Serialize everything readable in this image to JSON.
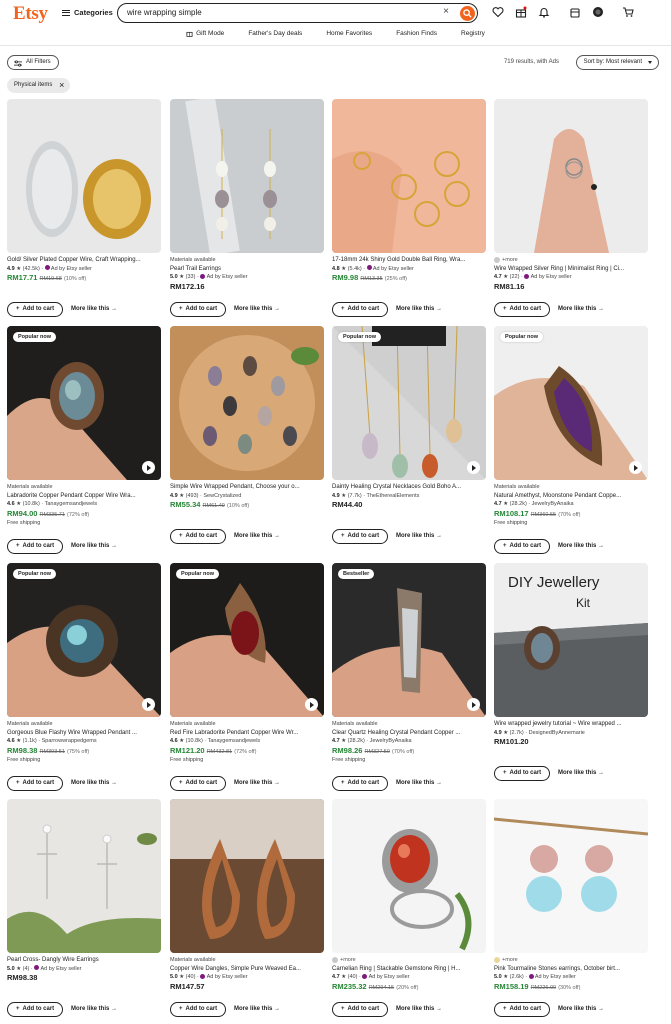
{
  "header": {
    "logo": "Etsy",
    "categories_label": "Categories",
    "search_value": "wire wrapping simple",
    "clear_symbol": "×"
  },
  "nav": [
    "Gift Mode",
    "Father's Day deals",
    "Home Favorites",
    "Fashion Finds",
    "Registry"
  ],
  "filters": {
    "all_filters": "All Filters",
    "results": "719 results, with Ads",
    "sort": "Sort by: Most relevant",
    "chip": "Physical items",
    "chip_x": "×"
  },
  "actions": {
    "add_to_cart": "Add to cart",
    "more_like_this": "More like this"
  },
  "colors": {
    "brand": "#f1641e",
    "sale_green": "#258635"
  },
  "products": [
    {
      "title": "Gold/ Silver Plated Copper Wire, Craft Wrapping...",
      "top": "",
      "rating": "4.9",
      "reviews": "(42.5k)",
      "seller": "Ad by Etsy seller",
      "ad": true,
      "price": "RM17.71",
      "orig": "RM19.68",
      "off": "(10% off)",
      "sale": true,
      "ship": "",
      "badge": "",
      "video": false
    },
    {
      "title": "Pearl Trail Earrings",
      "top": "Materials available",
      "rating": "5.0",
      "reviews": "(33)",
      "seller": "Ad by Etsy seller",
      "ad": true,
      "price": "RM172.16",
      "orig": "",
      "off": "",
      "sale": false,
      "ship": "",
      "badge": "",
      "video": false
    },
    {
      "title": "17-18mm 24k Shiny Gold Double Ball Ring, Wra...",
      "top": "",
      "rating": "4.8",
      "reviews": "(5.4k)",
      "seller": "Ad by Etsy seller",
      "ad": true,
      "price": "RM9.98",
      "orig": "RM13.35",
      "off": "(25% off)",
      "sale": true,
      "ship": "",
      "badge": "",
      "video": false
    },
    {
      "title": "Wire Wrapped Silver Ring | Minimalist Ring | Ci...",
      "top": "+more",
      "rating": "4.7",
      "reviews": "(22)",
      "seller": "Ad by Etsy seller",
      "ad": true,
      "price": "RM81.16",
      "orig": "",
      "off": "",
      "sale": false,
      "ship": "",
      "badge": "",
      "video": false
    },
    {
      "title": "Labradorite Copper Pendant Copper Wire Wra...",
      "top": "Materials available",
      "rating": "4.6",
      "reviews": "(10.8k)",
      "seller": "Tanaygemsandjewels",
      "ad": false,
      "price": "RM94.00",
      "orig": "RM335.71",
      "off": "(72% off)",
      "sale": true,
      "ship": "Free shipping",
      "badge": "Popular now",
      "video": true
    },
    {
      "title": "Simple Wire Wrapped Pendant, Choose your o...",
      "top": "",
      "rating": "4.9",
      "reviews": "(493)",
      "seller": "SewCrystalized",
      "ad": false,
      "price": "RM55.34",
      "orig": "RM61.49",
      "off": "(10% off)",
      "sale": true,
      "ship": "",
      "badge": "",
      "video": false
    },
    {
      "title": "Dainty Healing Crystal Necklaces Gold Boho A...",
      "top": "",
      "rating": "4.9",
      "reviews": "(7.7k)",
      "seller": "TheEtherealElements",
      "ad": false,
      "price": "RM44.40",
      "orig": "",
      "off": "",
      "sale": false,
      "ship": "",
      "badge": "Popular now",
      "video": true
    },
    {
      "title": "Natural Amethyst, Moonstone Pendant Coppe...",
      "top": "Materials available",
      "rating": "4.7",
      "reviews": "(28.2k)",
      "seller": "JewelryByAnaika",
      "ad": false,
      "price": "RM108.17",
      "orig": "RM360.55",
      "off": "(70% off)",
      "sale": true,
      "ship": "Free shipping",
      "badge": "Popular now",
      "video": true
    },
    {
      "title": "Gorgeous Blue Flashy Wire Wrapped Pendant ...",
      "top": "Materials available",
      "rating": "4.6",
      "reviews": "(1.1k)",
      "seller": "Sparrowwrappedgems",
      "ad": false,
      "price": "RM98.38",
      "orig": "RM393.51",
      "off": "(75% off)",
      "sale": true,
      "ship": "Free shipping",
      "badge": "Popular now",
      "video": true
    },
    {
      "title": "Red Fire Labradorite Pendant Copper Wire Wr...",
      "top": "Materials available",
      "rating": "4.6",
      "reviews": "(10.8k)",
      "seller": "Tanaygemsandjewels",
      "ad": false,
      "price": "RM121.20",
      "orig": "RM432.81",
      "off": "(72% off)",
      "sale": true,
      "ship": "Free shipping",
      "badge": "Popular now",
      "video": true
    },
    {
      "title": "Clear Quartz Healing Crystal Pendant Copper ...",
      "top": "Materials available",
      "rating": "4.7",
      "reviews": "(28.2k)",
      "seller": "JewelryByAnaika",
      "ad": false,
      "price": "RM98.26",
      "orig": "RM327.50",
      "off": "(70% off)",
      "sale": true,
      "ship": "Free shipping",
      "badge": "Bestseller",
      "video": true
    },
    {
      "title": "Wire wrapped jewelry tutorial ~ Wire wrapped ...",
      "top": "",
      "rating": "4.9",
      "reviews": "(2.7k)",
      "seller": "DesignedByAnnemarie",
      "ad": false,
      "price": "RM101.20",
      "orig": "",
      "off": "",
      "sale": false,
      "ship": "",
      "badge": "",
      "video": false
    },
    {
      "title": "Pearl Cross- Dangly Wire Earrings",
      "top": "",
      "rating": "5.0",
      "reviews": "(4)",
      "seller": "Ad by Etsy seller",
      "ad": true,
      "price": "RM98.38",
      "orig": "",
      "off": "",
      "sale": false,
      "ship": "",
      "badge": "",
      "video": false
    },
    {
      "title": "Copper Wire Dangles, Simple Pure Weaved Ea...",
      "top": "Materials available",
      "rating": "5.0",
      "reviews": "(40)",
      "seller": "Ad by Etsy seller",
      "ad": true,
      "price": "RM147.57",
      "orig": "",
      "off": "",
      "sale": false,
      "ship": "",
      "badge": "",
      "video": false
    },
    {
      "title": "Carnelian Ring | Stackable Gemstone Ring | H...",
      "top": "+more",
      "rating": "4.7",
      "reviews": "(40)",
      "seller": "Ad by Etsy seller",
      "ad": true,
      "price": "RM235.32",
      "orig": "RM294.15",
      "off": "(20% off)",
      "sale": true,
      "ship": "",
      "badge": "",
      "video": false
    },
    {
      "title": "Pink Tourmaline Stones earrings, October birt...",
      "top": "+more",
      "rating": "5.0",
      "reviews": "(2.6k)",
      "seller": "Ad by Etsy seller",
      "ad": true,
      "price": "RM158.19",
      "orig": "RM226.00",
      "off": "(30% off)",
      "sale": true,
      "ship": "",
      "badge": "",
      "video": false
    }
  ],
  "tutorial_image_text": {
    "heading": "DIY Jewellery",
    "sub": "Kit"
  }
}
